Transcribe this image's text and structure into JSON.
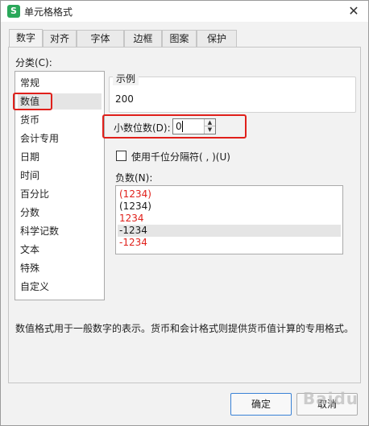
{
  "window": {
    "title": "单元格格式",
    "app_icon": "S"
  },
  "tabs": [
    {
      "label": "数字",
      "active": true
    },
    {
      "label": "对齐",
      "active": false
    },
    {
      "label": "字体",
      "active": false
    },
    {
      "label": "边框",
      "active": false
    },
    {
      "label": "图案",
      "active": false
    },
    {
      "label": "保护",
      "active": false
    }
  ],
  "category": {
    "label": "分类(C):",
    "items": [
      "常规",
      "数值",
      "货币",
      "会计专用",
      "日期",
      "时间",
      "百分比",
      "分数",
      "科学记数",
      "文本",
      "特殊",
      "自定义"
    ],
    "selected": "数值"
  },
  "sample": {
    "legend": "示例",
    "value": "200"
  },
  "decimal": {
    "label": "小数位数(D):",
    "value": "0"
  },
  "thousands": {
    "label": "使用千位分隔符( , )(U)",
    "checked": false
  },
  "negative": {
    "label": "负数(N):",
    "items": [
      {
        "text": "(1234)",
        "color": "#e0201b"
      },
      {
        "text": "(1234)",
        "color": "#1a1a1a"
      },
      {
        "text": "1234",
        "color": "#e0201b"
      },
      {
        "text": "-1234",
        "color": "#1a1a1a",
        "selected": true
      },
      {
        "text": "-1234",
        "color": "#e0201b"
      }
    ]
  },
  "description": "数值格式用于一般数字的表示。货币和会计格式则提供货币值计算的专用格式。",
  "buttons": {
    "ok": "确定",
    "cancel": "取消"
  },
  "watermark": "Baidu",
  "colors": {
    "highlight_red": "#e0201b",
    "icon_green": "#2aa85a"
  }
}
